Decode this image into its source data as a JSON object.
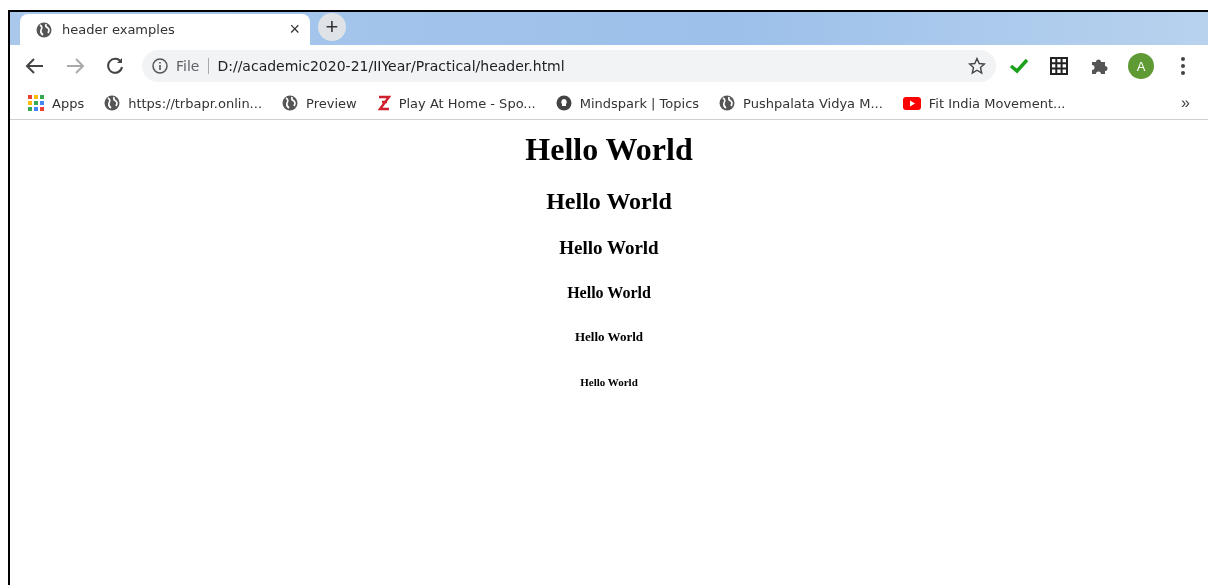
{
  "tab": {
    "title": "header examples",
    "close": "×",
    "selected": true
  },
  "new_tab": "+",
  "address_bar": {
    "scheme": "File",
    "url": "D://academic2020-21/IIYear/Practical/header.html"
  },
  "profile": "A",
  "bookmarks": [
    {
      "kind": "apps",
      "label": "Apps"
    },
    {
      "kind": "globe",
      "label": "https://trbapr.onlin..."
    },
    {
      "kind": "globe",
      "label": "Preview"
    },
    {
      "kind": "z",
      "label": "Play At Home - Spo..."
    },
    {
      "kind": "bulb",
      "label": "Mindspark | Topics"
    },
    {
      "kind": "globe",
      "label": "Pushpalata Vidya M..."
    },
    {
      "kind": "youtube",
      "label": "Fit India Movement..."
    }
  ],
  "more_bookmarks": "»",
  "headings": [
    {
      "kind": "h1",
      "text": "Hello World"
    },
    {
      "kind": "h2",
      "text": "Hello World"
    },
    {
      "kind": "h3",
      "text": "Hello World"
    },
    {
      "kind": "h4",
      "text": "Hello World"
    },
    {
      "kind": "h5",
      "text": "Hello World"
    },
    {
      "kind": "h6",
      "text": "Hello World"
    }
  ]
}
